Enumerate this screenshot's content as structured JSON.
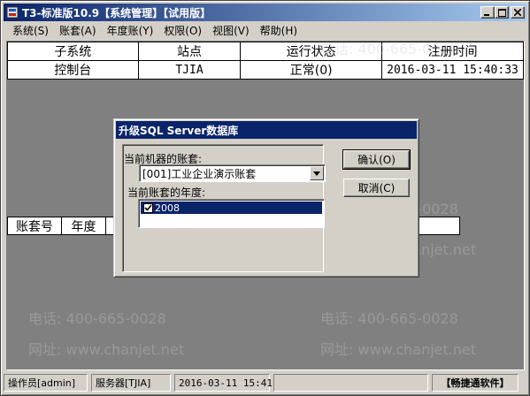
{
  "window": {
    "title": "T3-标准版10.9【系统管理】【试用版】",
    "minimize": "_",
    "maximize": "□",
    "close": "×"
  },
  "menubar": {
    "items": [
      "系统(S)",
      "账套(A)",
      "年度账(Y)",
      "权限(O)",
      "视图(V)",
      "帮助(H)"
    ]
  },
  "top_table": {
    "headers": [
      "子系统",
      "站点",
      "运行状态",
      "注册时间"
    ],
    "rows": [
      [
        "控制台",
        "TJIA",
        "正常(0)",
        "2016-03-11 15:40:33"
      ]
    ]
  },
  "second_table": {
    "headers": [
      "账套号",
      "年度"
    ]
  },
  "watermark": {
    "phone": "电话: 400-665-0028",
    "web": "网址: www.chanjet.net"
  },
  "dialog": {
    "title": "升级SQL Server数据库",
    "account_label": "当前机器的账套:",
    "account_value": "[001]工业企业演示账套",
    "year_label": "当前账套的年度:",
    "years": [
      {
        "label": "2008",
        "checked": true
      }
    ],
    "ok_button": "确认(O)",
    "cancel_button": "取消(C)"
  },
  "statusbar": {
    "operator": "操作员[admin]",
    "server": "服务器[TJIA]",
    "datetime": "2016-03-11 15:41",
    "brand": "【畅捷通软件】"
  },
  "colors": {
    "titlebar": "#0a246a",
    "face": "#d4d0c8",
    "workspace": "#808080"
  }
}
